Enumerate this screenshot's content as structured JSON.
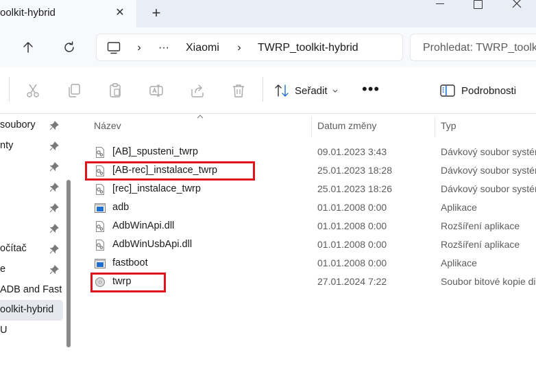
{
  "window": {
    "tab_title": "oolkit-hybrid",
    "tab_close": "✕",
    "new_tab": "+"
  },
  "address": {
    "overflow": "···",
    "breadcrumb": [
      "Xiaomi",
      "TWRP_toolkit-hybrid"
    ],
    "separator": "›",
    "search_placeholder": "Prohledat: TWRP_toolkit-hybrid"
  },
  "toolbar": {
    "sort_label": "Seřadit",
    "more": "•••",
    "details_label": "Podrobnosti"
  },
  "nav": {
    "items": [
      {
        "label": "soubory",
        "pinned": true
      },
      {
        "label": "nty",
        "pinned": true
      },
      {
        "label": "",
        "pinned": true
      },
      {
        "label": "",
        "pinned": true
      },
      {
        "label": "",
        "pinned": true
      },
      {
        "label": "",
        "pinned": true
      },
      {
        "label": "očítač",
        "pinned": true
      },
      {
        "label": "e",
        "pinned": true
      },
      {
        "label": " ADB and Fastboot",
        "pinned": false
      },
      {
        "label": "oolkit-hybrid",
        "pinned": false,
        "selected": true
      },
      {
        "label": "U",
        "pinned": false
      }
    ]
  },
  "columns": {
    "name": "Název",
    "date": "Datum změny",
    "type": "Typ"
  },
  "files": [
    {
      "name": "[AB]_spusteni_twrp",
      "date": "09.01.2023 3:43",
      "type": "Dávkový soubor systému Windows",
      "icon": "batch-file-icon",
      "highlighted": false
    },
    {
      "name": "[AB-rec]_instalace_twrp",
      "date": "25.01.2023 18:28",
      "type": "Dávkový soubor systému Windows",
      "icon": "batch-file-icon",
      "highlighted": true
    },
    {
      "name": "[rec]_instalace_twrp",
      "date": "25.01.2023 18:26",
      "type": "Dávkový soubor systému Windows",
      "icon": "batch-file-icon",
      "highlighted": false
    },
    {
      "name": "adb",
      "date": "01.01.2008 0:00",
      "type": "Aplikace",
      "icon": "application-icon",
      "highlighted": false
    },
    {
      "name": "AdbWinApi.dll",
      "date": "01.01.2008 0:00",
      "type": "Rozšíření aplikace",
      "icon": "dll-file-icon",
      "highlighted": false
    },
    {
      "name": "AdbWinUsbApi.dll",
      "date": "01.01.2008 0:00",
      "type": "Rozšíření aplikace",
      "icon": "dll-file-icon",
      "highlighted": false
    },
    {
      "name": "fastboot",
      "date": "01.01.2008 0:00",
      "type": "Aplikace",
      "icon": "application-icon",
      "highlighted": false
    },
    {
      "name": "twrp",
      "date": "27.01.2024 7:22",
      "type": "Soubor bitové kopie disku",
      "icon": "disc-image-icon",
      "highlighted": true
    }
  ],
  "colors": {
    "highlight_box": "#e0121c",
    "tabstrip_bg": "#e9eef6",
    "addressrow_bg": "#f7f9fc",
    "app_icon_blue": "#1f6fd1",
    "details_icon_blue": "#1f6fd1"
  }
}
